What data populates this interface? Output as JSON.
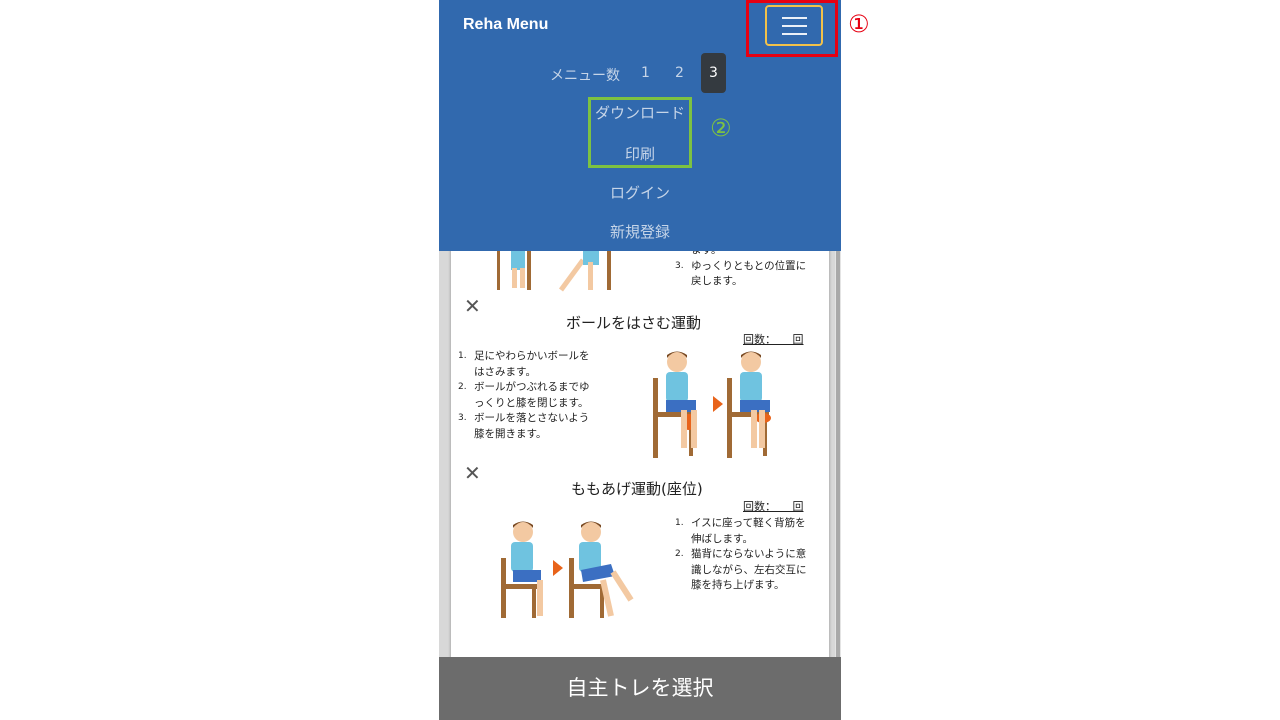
{
  "navbar": {
    "brand": "Reha Menu",
    "menu_count_label": "メニュー数",
    "pages": [
      "1",
      "2",
      "3"
    ],
    "active_page": "3",
    "links": {
      "download": "ダウンロード",
      "print": "印刷",
      "login": "ログイン",
      "register": "新規登録"
    }
  },
  "annotations": {
    "mark1": "①",
    "mark2": "②",
    "mark1_color": "#e60012",
    "mark2_color": "#7dc242"
  },
  "sheet": {
    "top_partial_steps": [
      {
        "num": "",
        "text": "ます。"
      },
      {
        "num": "3.",
        "text": "ゆっくりともとの位置に"
      },
      {
        "num": "",
        "text": "戻します。"
      }
    ],
    "exercises": [
      {
        "title": "ボールをはさむ運動",
        "count_label": "回数：　　回",
        "steps": [
          {
            "num": "1.",
            "text": "足にやわらかいボールを"
          },
          {
            "num": "",
            "text": "はさみます。"
          },
          {
            "num": "2.",
            "text": "ボールがつぶれるまでゆ"
          },
          {
            "num": "",
            "text": "っくりと膝を閉じます。"
          },
          {
            "num": "3.",
            "text": "ボールを落とさないよう"
          },
          {
            "num": "",
            "text": "膝を開きます。"
          }
        ]
      },
      {
        "title": "ももあげ運動(座位)",
        "count_label": "回数：　　回",
        "steps": [
          {
            "num": "1.",
            "text": "イスに座って軽く背筋を"
          },
          {
            "num": "",
            "text": "伸ばします。"
          },
          {
            "num": "2.",
            "text": "猫背にならないように意"
          },
          {
            "num": "",
            "text": "識しながら、左右交互に"
          },
          {
            "num": "",
            "text": "膝を持ち上げます。"
          }
        ]
      }
    ]
  },
  "footer": {
    "button_label": "自主トレを選択"
  },
  "colors": {
    "navbar_bg": "#3169ae",
    "active_page_bg": "#343a40",
    "footer_bg": "#6c6c6c",
    "arrow": "#e8631a"
  }
}
